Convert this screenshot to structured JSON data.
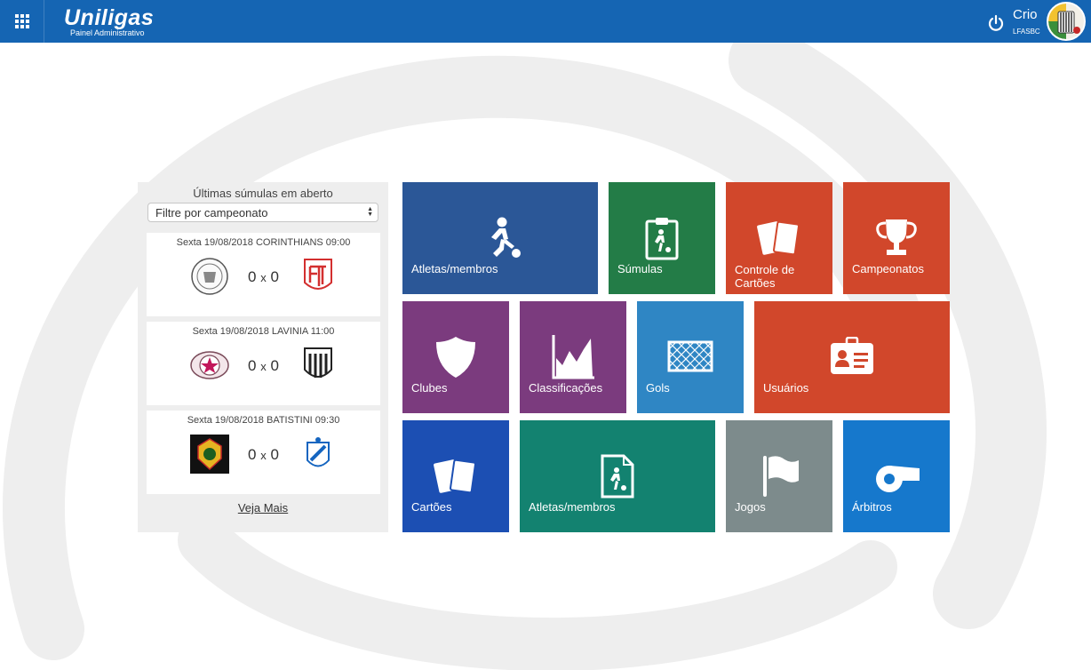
{
  "header": {
    "app_name": "Uniligas",
    "app_subtitle": "Painel Administrativo",
    "user_name": "Crio",
    "user_org": "LFASBC"
  },
  "panel": {
    "title": "Últimas súmulas em aberto",
    "filter_value": "Filtre por campeonato",
    "see_more": "Veja Mais",
    "matches": [
      {
        "title": "Sexta 19/08/2018 CORINTHIANS 09:00",
        "home_score": "0",
        "sep": "x",
        "away_score": "0"
      },
      {
        "title": "Sexta 19/08/2018 LAVINIA 11:00",
        "home_score": "0",
        "sep": "x",
        "away_score": "0"
      },
      {
        "title": "Sexta 19/08/2018 BATISTINI 09:30",
        "home_score": "0",
        "sep": "x",
        "away_score": "0"
      }
    ]
  },
  "tiles": [
    {
      "label": "Atletas/membros",
      "color": "#2b5797",
      "icon": "athlete-kicking-icon"
    },
    {
      "label": "Súmulas",
      "color": "#237c47",
      "icon": "clipboard-icon"
    },
    {
      "label": "Controle de Cartões",
      "color": "#d1472b",
      "icon": "cards-icon"
    },
    {
      "label": "Campeonatos",
      "color": "#d1472b",
      "icon": "trophy-icon"
    },
    {
      "label": "Clubes",
      "color": "#7b3b7e",
      "icon": "shield-icon"
    },
    {
      "label": "Classificações",
      "color": "#7b3b7e",
      "icon": "area-chart-icon"
    },
    {
      "label": "Gols",
      "color": "#2f86c4",
      "icon": "goal-net-icon"
    },
    {
      "label": "Usuários",
      "color": "#d1472b",
      "icon": "id-badge-icon"
    },
    {
      "label": "Cartões",
      "color": "#1c4fb3",
      "icon": "cards-icon"
    },
    {
      "label": "Atletas/membros",
      "color": "#138270",
      "icon": "athlete-document-icon"
    },
    {
      "label": "Jogos",
      "color": "#7d8b8c",
      "icon": "flag-icon"
    },
    {
      "label": "Árbitros",
      "color": "#1678cc",
      "icon": "whistle-icon"
    }
  ]
}
